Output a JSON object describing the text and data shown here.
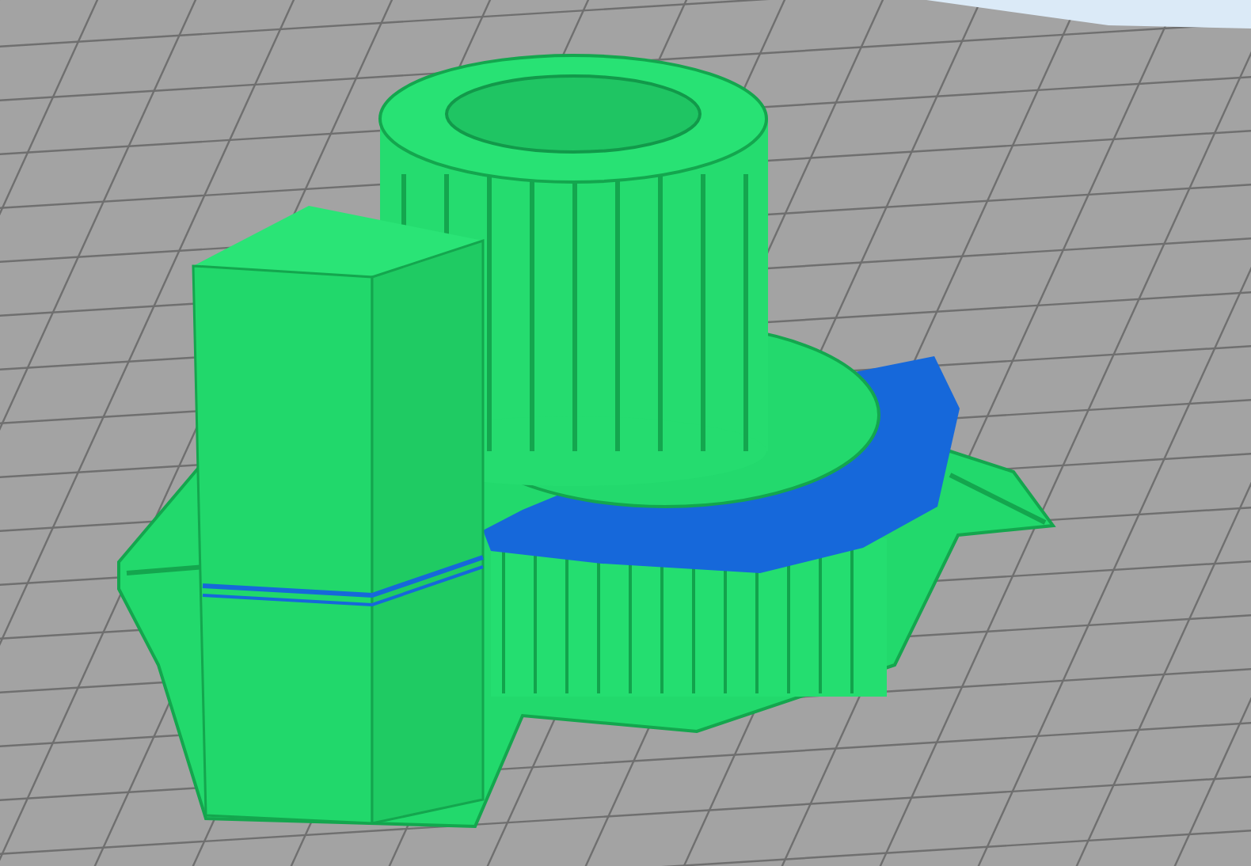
{
  "viewport": {
    "kind": "layer-preview"
  }
}
